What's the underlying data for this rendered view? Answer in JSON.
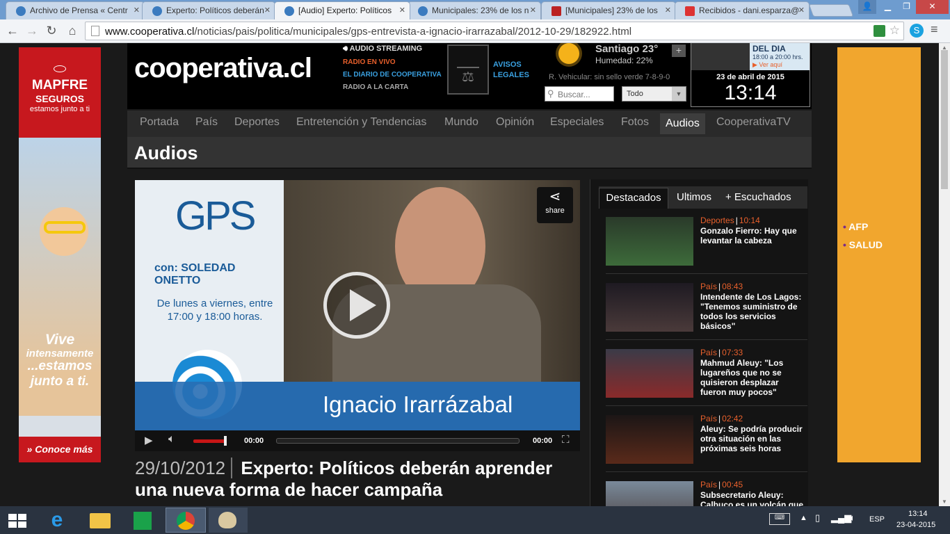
{
  "browser": {
    "tabs": [
      {
        "title": "Archivo de Prensa « Centr"
      },
      {
        "title": "Experto: Políticos deberán"
      },
      {
        "title": "[Audio] Experto: Políticos"
      },
      {
        "title": "Municipales: 23% de los n"
      },
      {
        "title": "[Municipales] 23% de los"
      },
      {
        "title": "Recibidos - dani.esparza@"
      }
    ],
    "url_host": "www.cooperativa.cl",
    "url_path": "/noticias/pais/politica/municipales/gps-entrevista-a-ignacio-irarrazabal/2012-10-29/182922.html"
  },
  "site": {
    "logo": "cooperativa.cl",
    "radio_links": [
      "AUDIO STREAMING",
      "RADIO EN VIVO",
      "EL DIARIO DE COOPERATIVA",
      "RADIO A LA CARTA"
    ],
    "avisos_legales": "AVISOS LEGALES",
    "weather_city": "Santiago 23°",
    "humidity": "Humedad: 22%",
    "vehicular": "R. Vehicular: sin sello verde 7-8-9-0",
    "search_placeholder": "Buscar...",
    "search_scope": "Todo",
    "promo_line1": "DEL DIA",
    "promo_line2": "18:00 a 20:00 hrs.",
    "promo_link": "Ver aquí",
    "date": "23 de abril de 2015",
    "time": "13:14"
  },
  "nav": [
    "Portada",
    "País",
    "Deportes",
    "Entretención y Tendencias",
    "Mundo",
    "Opinión",
    "Especiales",
    "Fotos",
    "Audios",
    "CooperativaTV"
  ],
  "nav_selected": "Audios",
  "section_title": "Audios",
  "player": {
    "show": "GPS",
    "host": "con: SOLEDAD ONETTO",
    "schedule": "De lunes a viernes, entre 17:00 y 18:00 horas.",
    "guest": "Ignacio Irarrázabal",
    "share": "share",
    "time_current": "00:00",
    "time_total": "00:00"
  },
  "article": {
    "date": "29/10/2012",
    "title": "Experto: Políticos deberán aprender una nueva forma de hacer campaña"
  },
  "sidebar": {
    "tabs": [
      "Destacados",
      "Ultimos",
      "+ Escuchados"
    ],
    "stories": [
      {
        "category": "Deportes",
        "time": "10:14",
        "title": "Gonzalo Fierro: Hay que levantar la cabeza"
      },
      {
        "category": "País",
        "time": "08:43",
        "title": "Intendente de Los Lagos: \"Tenemos suministro de todos los servicios básicos\""
      },
      {
        "category": "País",
        "time": "07:33",
        "title": "Mahmud Aleuy: \"Los lugareños que no se quisieron desplazar fueron muy pocos\""
      },
      {
        "category": "País",
        "time": "02:42",
        "title": "Aleuy: Se podría producir otra situación en las próximas seis horas"
      },
      {
        "category": "País",
        "time": "00:45",
        "title": "Subsecretario Aleuy: Calbuco es un volcán que"
      }
    ]
  },
  "ads": {
    "left_brand": "MAPFRE",
    "left_sub": "SEGUROS",
    "left_tag": "estamos junto a ti",
    "left_slogan1": "Vive",
    "left_slogan2": "intensamente",
    "left_slogan3": "...estamos",
    "left_slogan4": "junto a ti.",
    "left_cta": "» Conoce más",
    "right_items": [
      "AFP",
      "SALUD"
    ]
  },
  "taskbar": {
    "lang": "ESP",
    "time": "13:14",
    "date": "23-04-2015"
  }
}
